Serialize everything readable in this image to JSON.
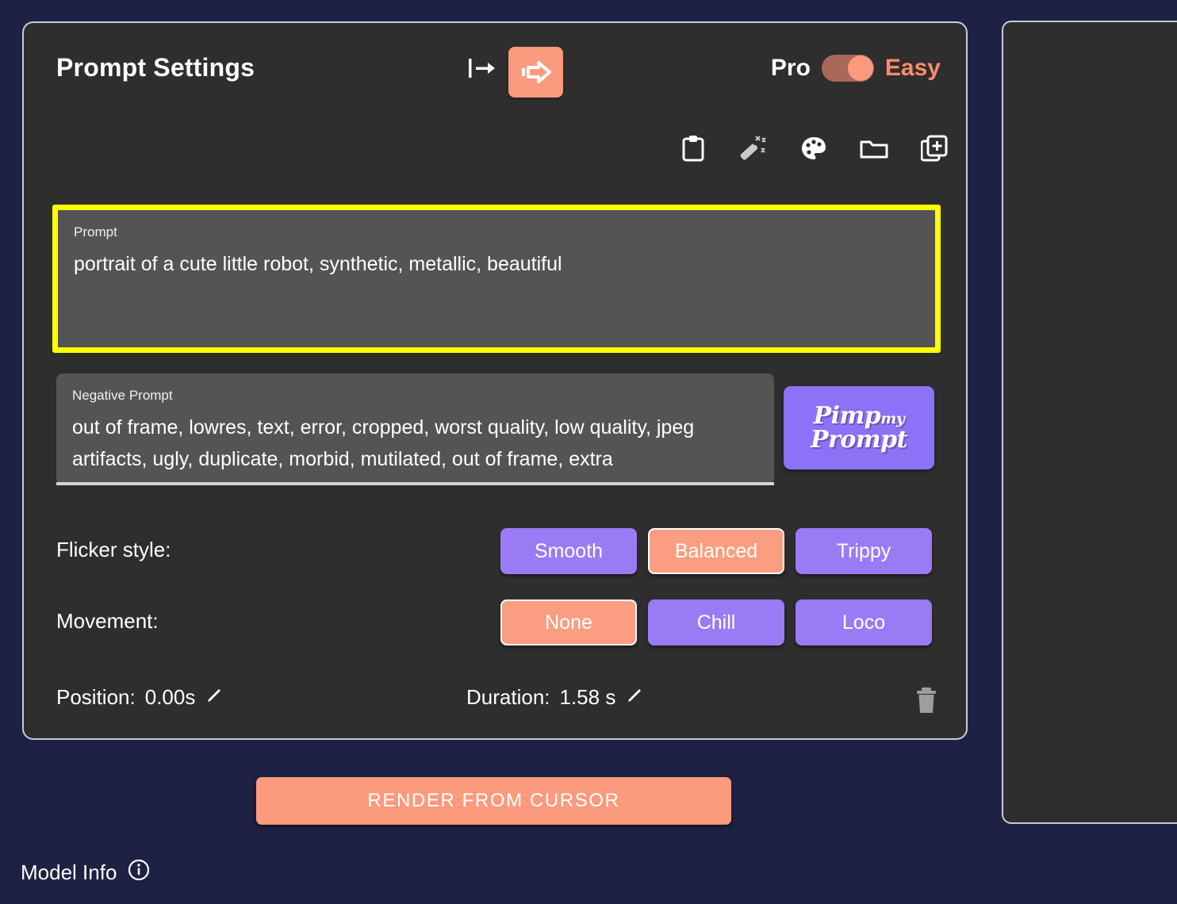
{
  "panel": {
    "title": "Prompt Settings",
    "mode": {
      "left_label": "Pro",
      "right_label": "Easy",
      "selected": "Easy"
    },
    "header_icons": [
      {
        "name": "indent-arrow-icon",
        "label": "|→"
      },
      {
        "name": "render-arrow-button",
        "label": "arrow-right-boxed"
      }
    ],
    "toolbar_icons": [
      {
        "name": "clipboard-icon",
        "label": "Paste prompt"
      },
      {
        "name": "magic-wand-icon",
        "label": "Enhance prompt"
      },
      {
        "name": "palette-icon",
        "label": "Style palette"
      },
      {
        "name": "folder-icon",
        "label": "Open folder"
      },
      {
        "name": "add-layer-icon",
        "label": "Add prompt"
      }
    ]
  },
  "prompt": {
    "label": "Prompt",
    "value": "portrait of a cute little robot, synthetic, metallic, beautiful",
    "highlighted": true,
    "highlight_color": "#ffff00"
  },
  "negative_prompt": {
    "label": "Negative Prompt",
    "value": "out of frame, lowres, text, error, cropped, worst quality, low quality, jpeg artifacts, ugly, duplicate, morbid, mutilated, out of frame, extra"
  },
  "pimp_button": {
    "line1": "Pimp",
    "small": "my",
    "line2": "Prompt"
  },
  "flicker": {
    "label": "Flicker style:",
    "options": [
      "Smooth",
      "Balanced",
      "Trippy"
    ],
    "selected": "Balanced"
  },
  "movement": {
    "label": "Movement:",
    "options": [
      "None",
      "Chill",
      "Loco"
    ],
    "selected": "None"
  },
  "timing": {
    "position_label": "Position:",
    "position_value": "0.00s",
    "duration_label": "Duration:",
    "duration_value": "1.58 s",
    "edit_icon": "✏",
    "delete_icon": "trash-icon"
  },
  "render_button": {
    "label": "RENDER FROM CURSOR"
  },
  "footer": {
    "model_info_label": "Model Info",
    "info_icon": "info-circle-icon"
  },
  "colors": {
    "background": "#1e2144",
    "panel": "#2e2e2e",
    "field": "#545454",
    "accent_salmon": "#fb9a7d",
    "accent_purple": "#9b7bf5",
    "highlight_yellow": "#ffff00"
  }
}
